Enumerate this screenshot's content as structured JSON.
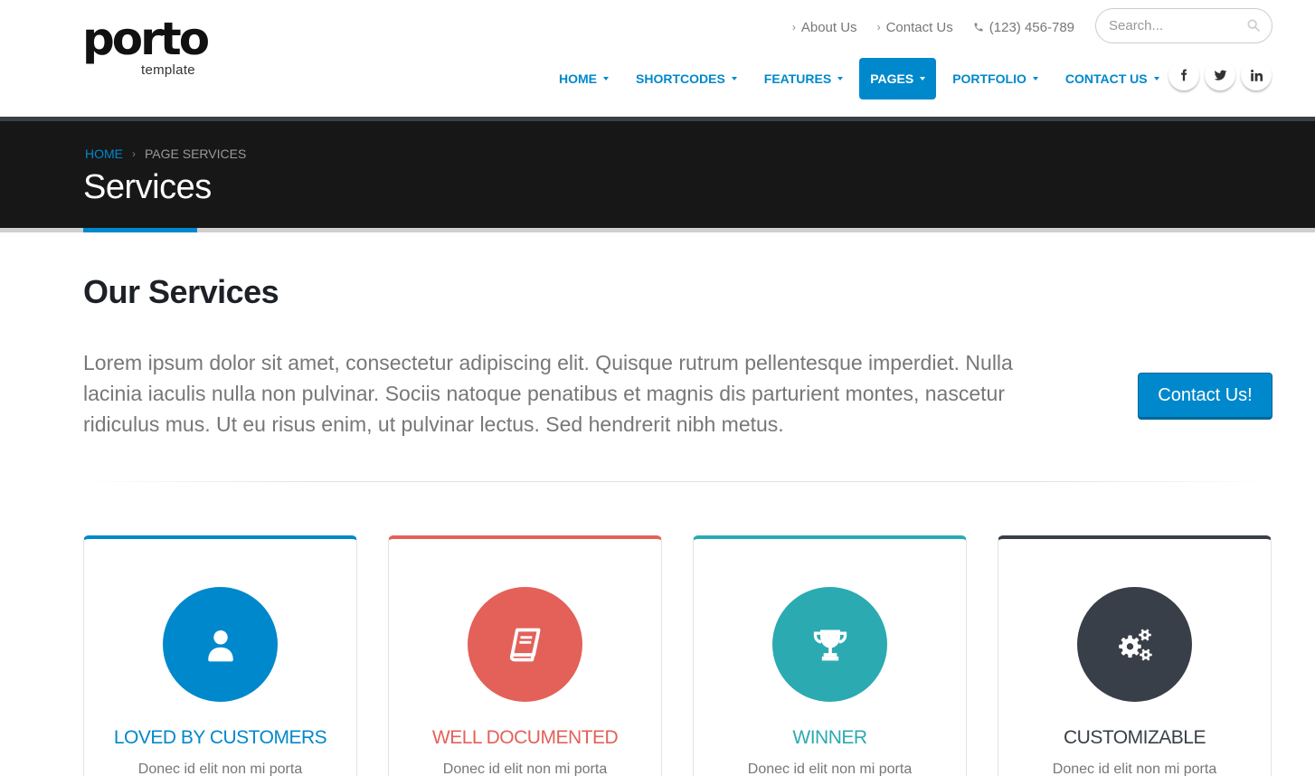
{
  "header": {
    "logo": {
      "main": "porto",
      "sub": "template"
    },
    "toplinks": [
      {
        "label": "About Us"
      },
      {
        "label": "Contact Us"
      }
    ],
    "phone": "(123) 456-789",
    "search": {
      "placeholder": "Search..."
    },
    "nav": [
      {
        "label": "HOME",
        "active": false
      },
      {
        "label": "SHORTCODES",
        "active": false
      },
      {
        "label": "FEATURES",
        "active": false
      },
      {
        "label": "PAGES",
        "active": true
      },
      {
        "label": "PORTFOLIO",
        "active": false
      },
      {
        "label": "CONTACT US",
        "active": false
      }
    ],
    "social": [
      {
        "icon": "facebook-icon",
        "glyph": "f"
      },
      {
        "icon": "twitter-icon",
        "glyph": "t"
      },
      {
        "icon": "linkedin-icon",
        "glyph": "in"
      }
    ]
  },
  "page_header": {
    "breadcrumb": {
      "home": "HOME",
      "current": "PAGE SERVICES"
    },
    "title": "Services"
  },
  "main": {
    "heading_light": "Our",
    "heading_bold": "Services",
    "lead": "Lorem ipsum dolor sit amet, consectetur adipiscing elit. Quisque rutrum pellentesque imperdiet. Nulla lacinia iaculis nulla non pulvinar. Sociis natoque penatibus et magnis dis parturient montes, nascetur ridiculus mus. Ut eu risus enim, ut pulvinar lectus. Sed hendrerit nibh metus.",
    "cta_label": "Contact Us!",
    "cards": [
      {
        "title": "LOVED BY CUSTOMERS",
        "text": "Donec id elit non mi porta",
        "icon": "user-icon",
        "color": "#0088cc"
      },
      {
        "title": "WELL DOCUMENTED",
        "text": "Donec id elit non mi porta",
        "icon": "book-icon",
        "color": "#e36159"
      },
      {
        "title": "WINNER",
        "text": "Donec id elit non mi porta",
        "icon": "trophy-icon",
        "color": "#2baab1"
      },
      {
        "title": "CUSTOMIZABLE",
        "text": "Donec id elit non mi porta",
        "icon": "gears-icon",
        "color": "#383f48"
      }
    ]
  },
  "colors": {
    "primary": "#0088cc",
    "dark_band": "#171717",
    "heading": "#1d2127"
  }
}
